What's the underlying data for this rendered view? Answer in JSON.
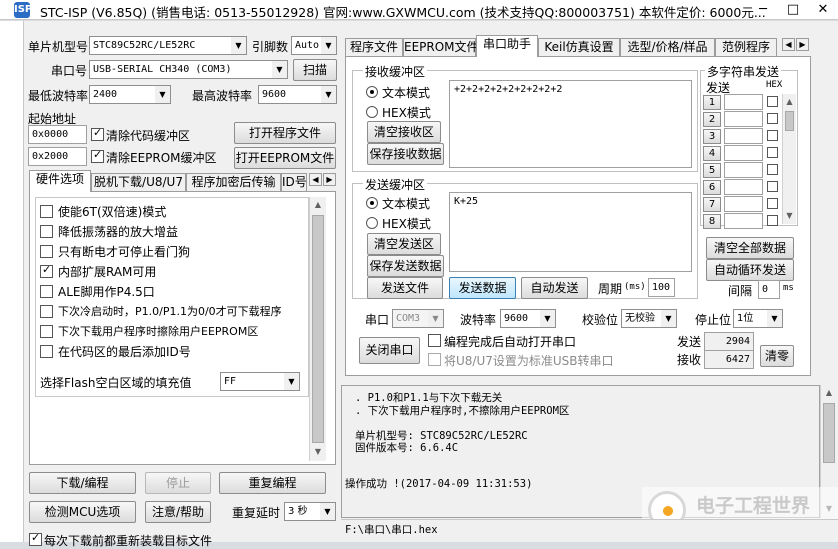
{
  "window": {
    "title": "STC-ISP (V6.85Q) (销售电话: 0513-55012928) 官网:www.GXWMCU.com  (技术支持QQ:800003751) 本软件定价: 6000元...",
    "icon": "ISP"
  },
  "left": {
    "mcu_label": "单片机型号",
    "mcu_value": "STC89C52RC/LE52RC",
    "pins_label": "引脚数",
    "pins_value": "Auto",
    "port_label": "串口号",
    "port_value": "USB-SERIAL CH340 (COM3)",
    "scan_button": "扫描",
    "min_baud_label": "最低波特率",
    "min_baud_value": "2400",
    "max_baud_label": "最高波特率",
    "max_baud_value": "9600",
    "start_addr_label": "起始地址",
    "addr1": "0x0000",
    "clear_code_label": "清除代码缓冲区",
    "open_program_button": "打开程序文件",
    "addr2": "0x2000",
    "clear_eeprom_label": "清除EEPROM缓冲区",
    "open_eeprom_button": "打开EEPROM文件",
    "tabs": [
      "硬件选项",
      "脱机下载/U8/U7",
      "程序加密后传输",
      "ID号"
    ],
    "options": [
      {
        "label": "使能6T(双倍速)模式",
        "checked": false
      },
      {
        "label": "降低振荡器的放大增益",
        "checked": false
      },
      {
        "label": "只有断电才可停止看门狗",
        "checked": false
      },
      {
        "label": "内部扩展RAM可用",
        "checked": true
      },
      {
        "label": "ALE脚用作P4.5口",
        "checked": false
      },
      {
        "label": "下次冷启动时，P1.0/P1.1为0/0才可下载程序",
        "checked": false
      },
      {
        "label": "下次下载用户程序时擦除用户EEPROM区",
        "checked": false
      },
      {
        "label": "在代码区的最后添加ID号",
        "checked": false
      }
    ],
    "fill_label": "选择Flash空白区域的填充值",
    "fill_value": "FF",
    "download_button": "下载/编程",
    "stop_button": "停止",
    "reprogram_button": "重复编程",
    "detect_button": "检测MCU选项",
    "help_button": "注意/帮助",
    "repeat_delay_label": "重复延时",
    "repeat_delay_value": "3 秒",
    "reload_label": "每次下载前都重新装载目标文件"
  },
  "right": {
    "tabs": [
      "程序文件",
      "EEPROM文件",
      "串口助手",
      "Keil仿真设置",
      "选型/价格/样品",
      "范例程序"
    ],
    "rx_group": "接收缓冲区",
    "text_mode": "文本模式",
    "hex_mode": "HEX模式",
    "clear_rx_button": "清空接收区",
    "save_rx_button": "保存接收数据",
    "rx_content": "+2+2+2+2+2+2+2+2+2",
    "tx_group": "发送缓冲区",
    "clear_tx_button": "清空发送区",
    "save_tx_button": "保存发送数据",
    "tx_content": "K+25",
    "send_file_button": "发送文件",
    "send_data_button": "发送数据",
    "auto_send_button": "自动发送",
    "period_label": "周期",
    "period_unit": "(ms)",
    "period_value": "100",
    "multi_title": "多字符串发送",
    "send_col": "发送",
    "hex_col": "HEX",
    "multi_rows": [
      "1",
      "2",
      "3",
      "4",
      "5",
      "6",
      "7",
      "8"
    ],
    "clear_all_button": "清空全部数据",
    "auto_loop_button": "自动循环发送",
    "interval_label": "间隔",
    "interval_value": "0",
    "interval_unit": "ms",
    "serial_label": "串口",
    "serial_value": "COM3",
    "baud_label": "波特率",
    "baud_value": "9600",
    "parity_label": "校验位",
    "parity_value": "无校验",
    "stopbit_label": "停止位",
    "stopbit_value": "1位",
    "close_port_button": "关闭串口",
    "auto_open_label": "编程完成后自动打开串口",
    "usb_label": "将U8/U7设置为标准USB转串口",
    "send_count_label": "发送",
    "send_count": "2904",
    "recv_count_label": "接收",
    "recv_count": "6427",
    "clear_counts_button": "清零"
  },
  "log": {
    "line1": ". P1.0和P1.1与下次下载无关",
    "line2": ". 下次下载用户程序时,不擦除用户EEPROM区",
    "mcu_line": "单片机型号: STC89C52RC/LE52RC",
    "fw_line": "固件版本号: 6.6.4C",
    "result_line": "操作成功 !(2017-04-09 11:31:53)"
  },
  "status_path": "F:\\串口\\串口.hex",
  "watermark": "电子工程世界"
}
